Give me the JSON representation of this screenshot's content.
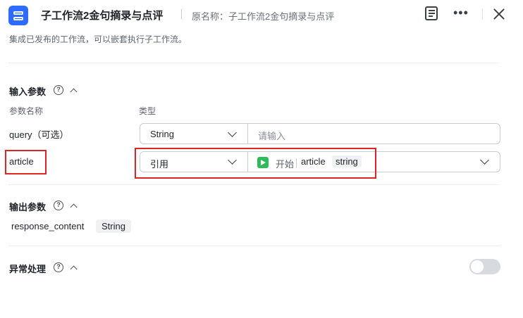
{
  "header": {
    "title": "子工作流2金句摘录与点评",
    "original_name": "原名称：子工作流2金句摘录与点评",
    "description": "集成已发布的工作流，可以嵌套执行子工作流。",
    "more_glyph": "•••"
  },
  "input_params": {
    "title": "输入参数",
    "col_name": "参数名称",
    "col_type": "类型",
    "rows": [
      {
        "name": "query（可选）",
        "type": "String",
        "placeholder": "请输入"
      },
      {
        "name": "article",
        "type": "引用",
        "ref_node": "开始",
        "ref_var": "article",
        "ref_type": "string"
      }
    ]
  },
  "output_params": {
    "title": "输出参数",
    "name": "response_content",
    "type": "String"
  },
  "exception": {
    "title": "异常处理",
    "enabled": false
  },
  "icons": {
    "help": "?",
    "app": "workflow-icon",
    "note": "note-icon",
    "close": "close-icon"
  },
  "colors": {
    "accent": "#2f6bff",
    "start_node": "#2ebc59",
    "highlight": "#e02424"
  }
}
